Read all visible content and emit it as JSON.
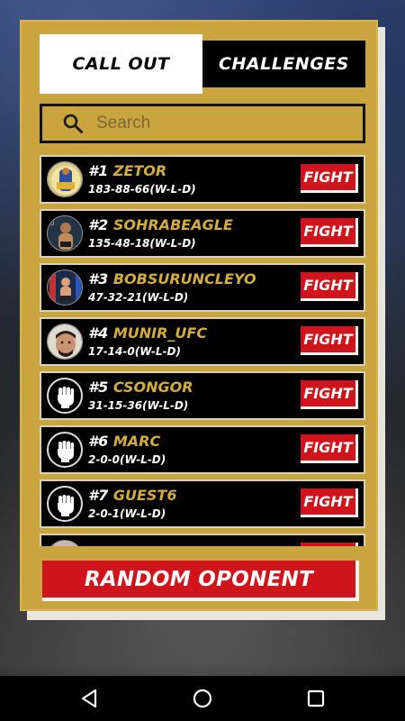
{
  "tabs": {
    "call_out": "CALL OUT",
    "challenges": "CHALLENGES",
    "active": "call_out"
  },
  "search": {
    "placeholder": "Search",
    "value": ""
  },
  "players": [
    {
      "rank": "#1",
      "name": "ZETOR",
      "record": "183-88-66(W-L-D)",
      "avatar": "photo",
      "fight_label": "FIGHT"
    },
    {
      "rank": "#2",
      "name": "SOHRABEAGLE",
      "record": "135-48-18(W-L-D)",
      "avatar": "photo",
      "fight_label": "FIGHT"
    },
    {
      "rank": "#3",
      "name": "BOBSURUNCLEYO",
      "record": "47-32-21(W-L-D)",
      "avatar": "photo",
      "fight_label": "FIGHT"
    },
    {
      "rank": "#4",
      "name": "MUNIR_UFC",
      "record": "17-14-0(W-L-D)",
      "avatar": "photo",
      "fight_label": "FIGHT"
    },
    {
      "rank": "#5",
      "name": "CSONGOR",
      "record": "31-15-36(W-L-D)",
      "avatar": "fist",
      "fight_label": "FIGHT"
    },
    {
      "rank": "#6",
      "name": "MARC",
      "record": "2-0-0(W-L-D)",
      "avatar": "fist",
      "fight_label": "FIGHT"
    },
    {
      "rank": "#7",
      "name": "GUEST6",
      "record": "2-0-1(W-L-D)",
      "avatar": "fist",
      "fight_label": "FIGHT"
    }
  ],
  "random_button": "RANDOM OPONENT",
  "colors": {
    "gold": "#c9a43f",
    "name_gold": "#d5ad3e",
    "fight_red": "#d0141b",
    "row_black": "#000000"
  },
  "icons": {
    "search": "search-icon",
    "back": "back-triangle-icon",
    "home": "home-circle-icon",
    "recent": "recent-apps-square-icon"
  }
}
